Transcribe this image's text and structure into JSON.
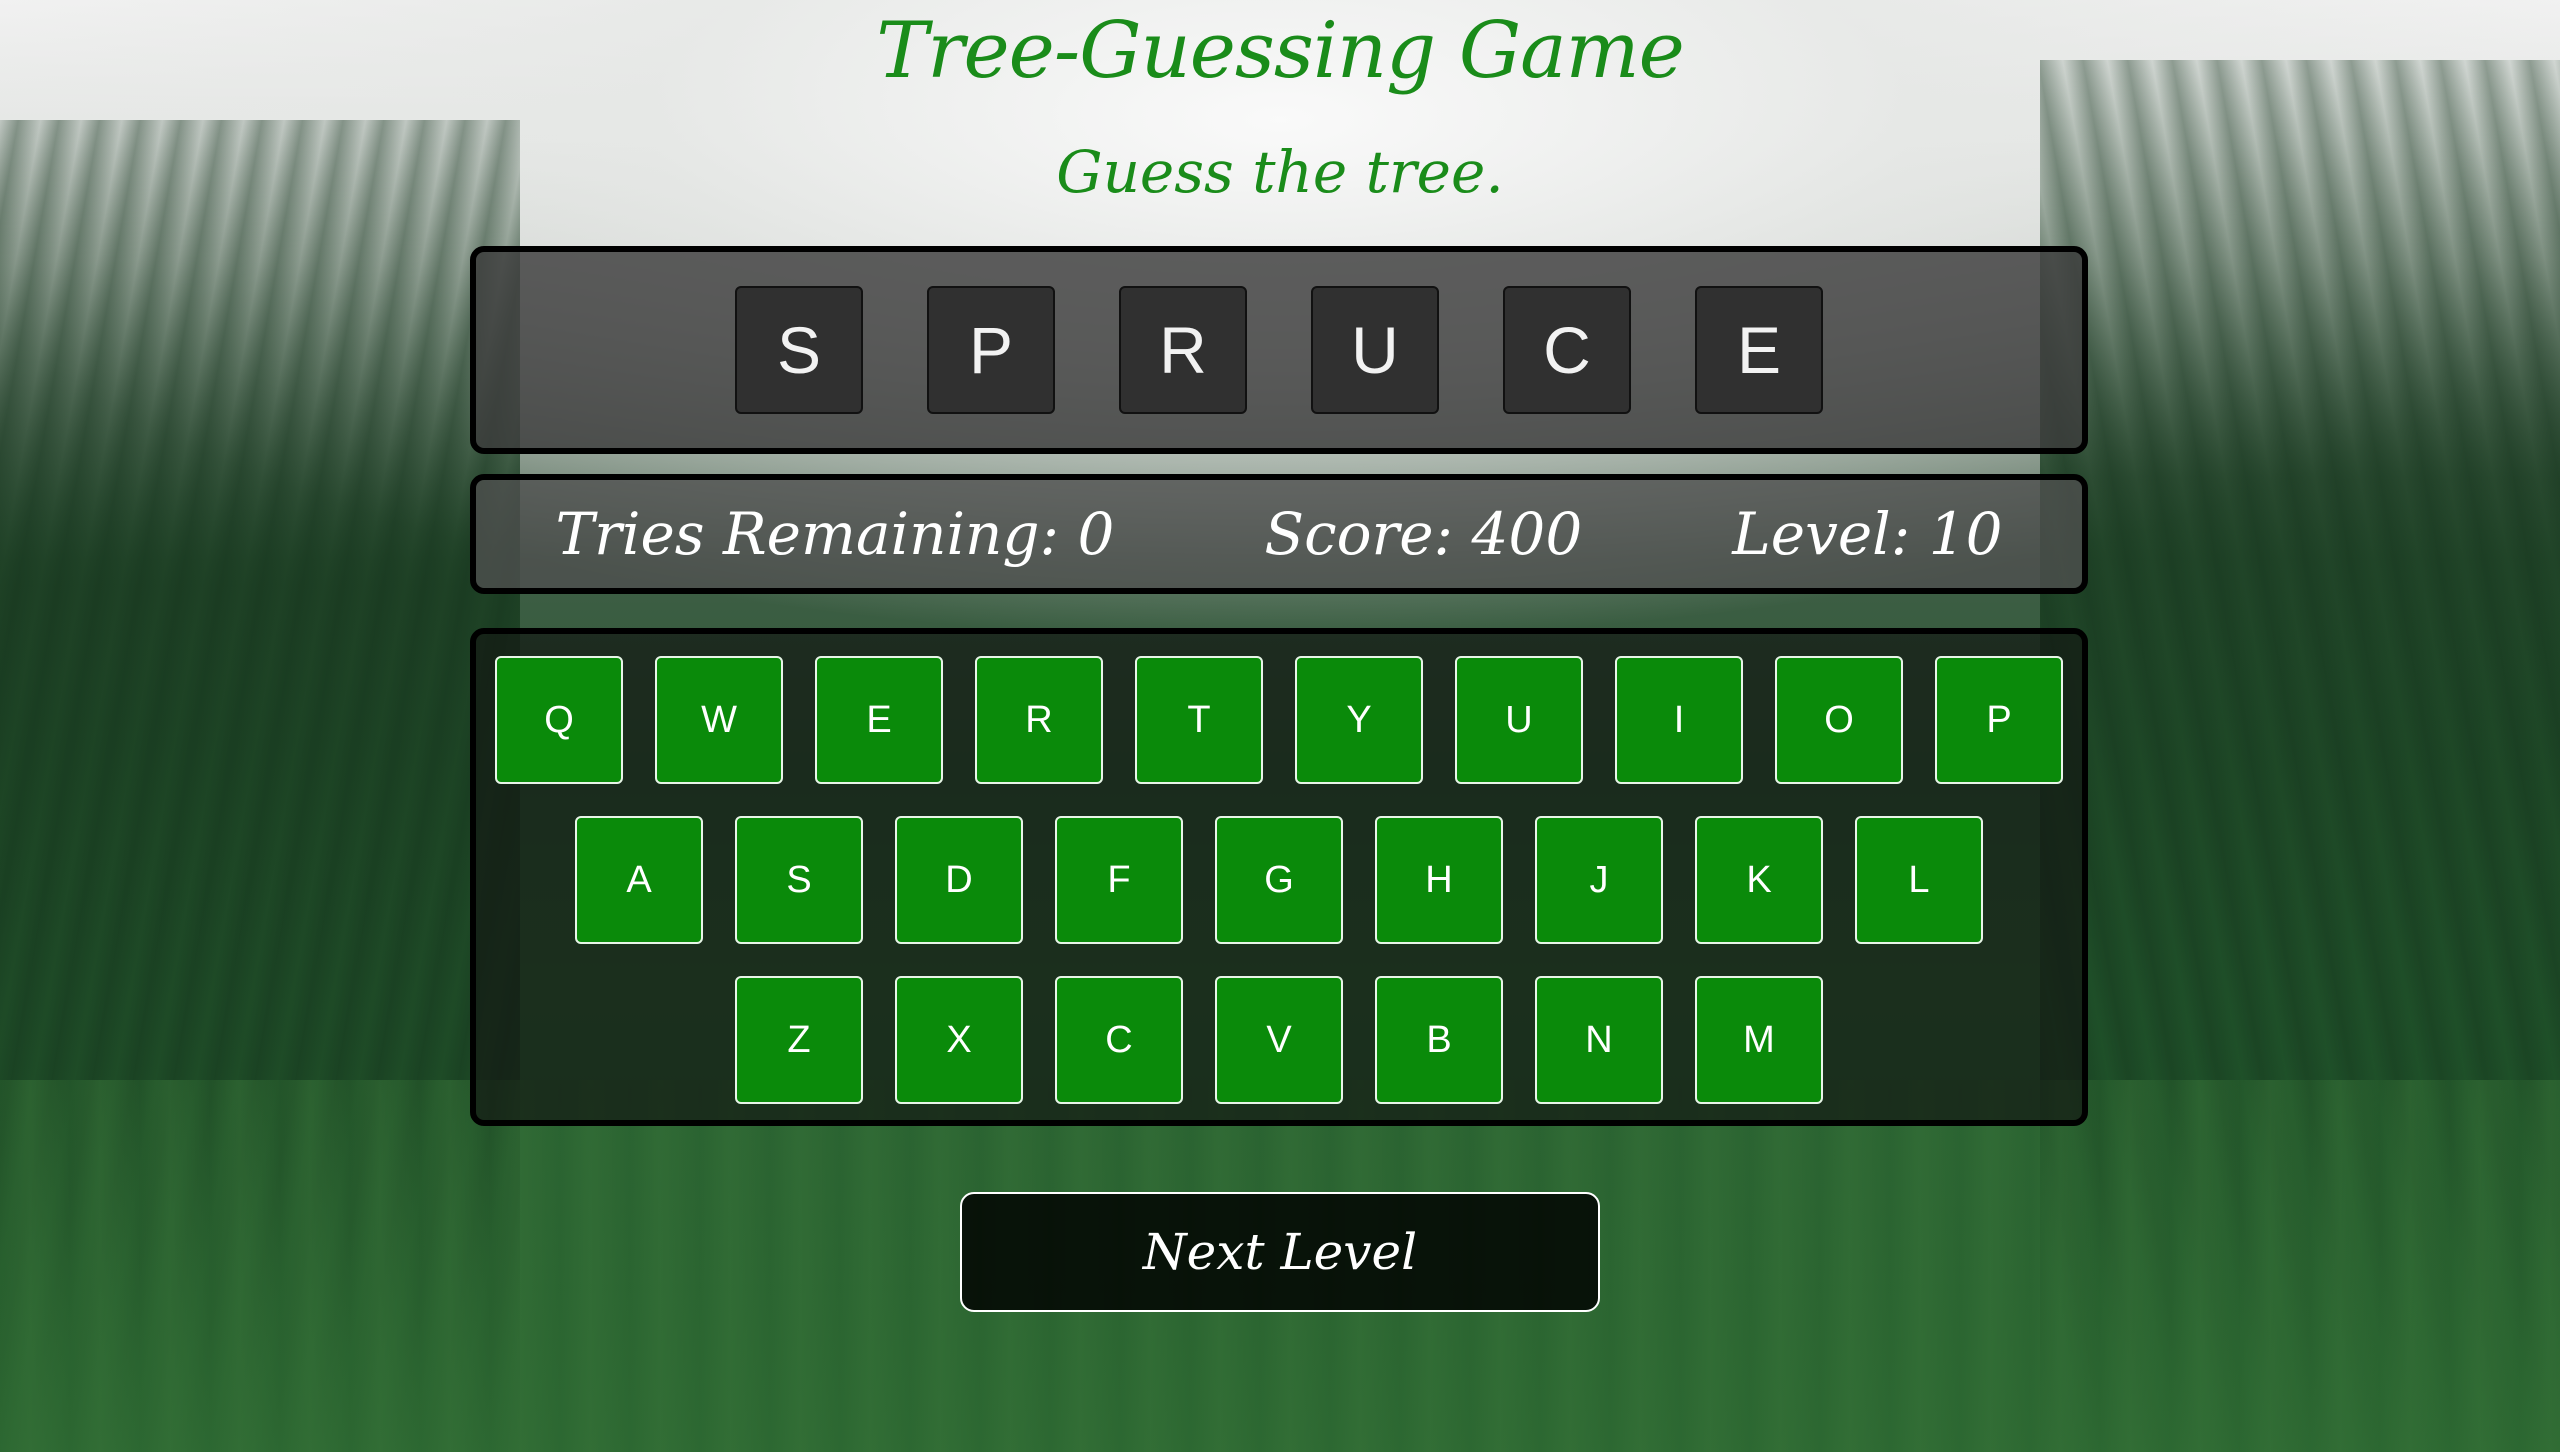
{
  "header": {
    "title": "Tree-Guessing Game",
    "subtitle": "Guess the tree."
  },
  "word": {
    "letters": [
      "S",
      "P",
      "R",
      "U",
      "C",
      "E"
    ]
  },
  "status": {
    "tries": "Tries Remaining: 0",
    "score": "Score: 400",
    "level": "Level: 10"
  },
  "keyboard": {
    "row1": [
      "Q",
      "W",
      "E",
      "R",
      "T",
      "Y",
      "U",
      "I",
      "O",
      "P"
    ],
    "row2": [
      "A",
      "S",
      "D",
      "F",
      "G",
      "H",
      "J",
      "K",
      "L"
    ],
    "row3": [
      "Z",
      "X",
      "C",
      "V",
      "B",
      "N",
      "M"
    ]
  },
  "actions": {
    "next_level_label": "Next Level"
  },
  "colors": {
    "title": "#1a8c1a",
    "key_background": "#0a8a0a",
    "tile_background": "#303030"
  }
}
